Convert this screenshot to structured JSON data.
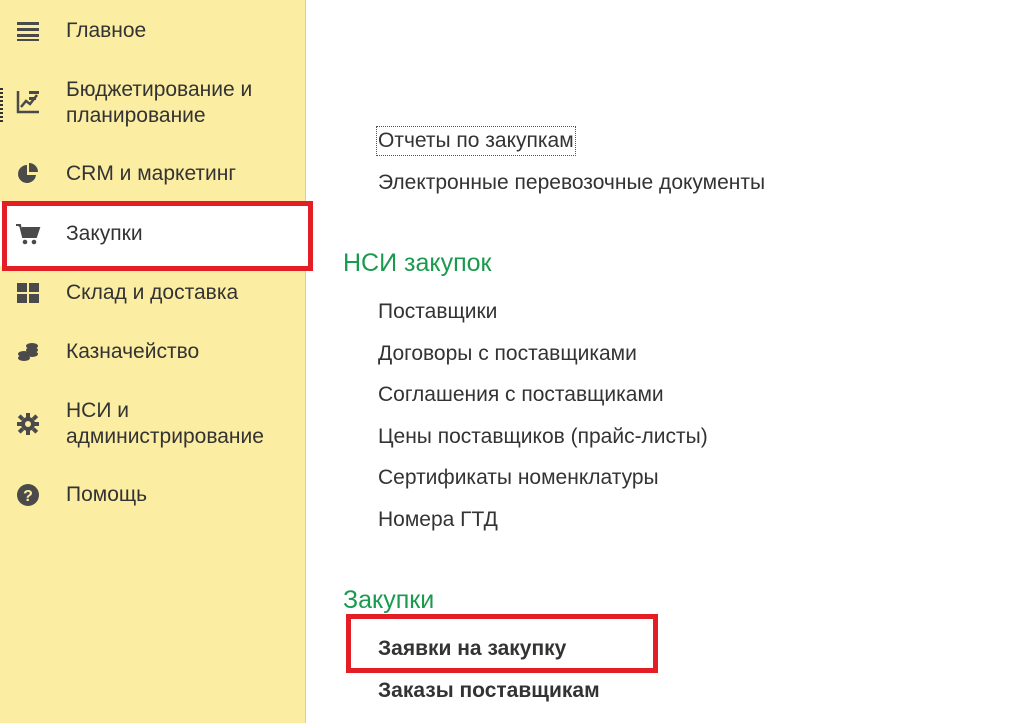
{
  "sidebar": {
    "items": [
      {
        "label": "Главное",
        "icon": "menu-icon"
      },
      {
        "label": "Бюджетирование и планирование",
        "icon": "budget-chart-icon"
      },
      {
        "label": "CRM и маркетинг",
        "icon": "pie-chart-icon"
      },
      {
        "label": "Закупки",
        "icon": "shopping-cart-icon"
      },
      {
        "label": "Склад и доставка",
        "icon": "warehouse-grid-icon"
      },
      {
        "label": "Казначейство",
        "icon": "coins-icon"
      },
      {
        "label": "НСИ и администрирование",
        "icon": "gear-icon"
      },
      {
        "label": "Помощь",
        "icon": "help-icon"
      }
    ]
  },
  "main": {
    "top_links": [
      "Отчеты по закупкам",
      "Электронные перевозочные документы"
    ],
    "nsi_section": {
      "title": "НСИ закупок",
      "links": [
        "Поставщики",
        "Договоры с поставщиками",
        "Соглашения с поставщиками",
        "Цены поставщиков (прайс-листы)",
        "Сертификаты номенклатуры",
        "Номера ГТД"
      ]
    },
    "purchases_section": {
      "title": "Закупки",
      "links": [
        "Заявки на закупку",
        "Заказы поставщикам"
      ]
    }
  },
  "colors": {
    "sidebar_bg": "#fbeda1",
    "section_title": "#1a9a4f",
    "highlight": "#e31e24"
  }
}
